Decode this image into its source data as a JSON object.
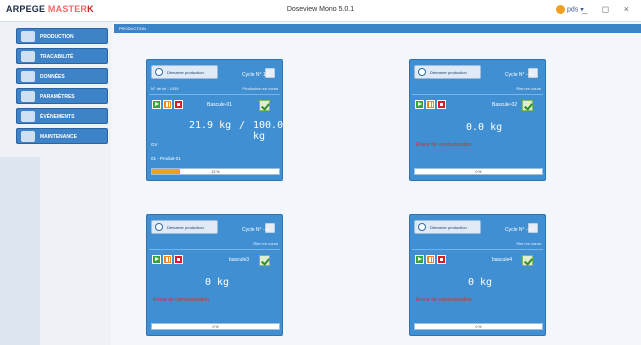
{
  "app": {
    "brand_parts": [
      "ARPEGE ",
      "MASTER",
      "K"
    ],
    "window_title": "Doseview Mono 5.0.1",
    "user": "pds",
    "window_buttons": "_ ◻ ×"
  },
  "sidebar": {
    "items": [
      {
        "label": "PRODUCTION",
        "icon": "production-icon"
      },
      {
        "label": "TRACABILITÉ",
        "icon": "traceability-icon"
      },
      {
        "label": "DONNÉES",
        "icon": "data-icon"
      },
      {
        "label": "PARAMÈTRES",
        "icon": "settings-icon"
      },
      {
        "label": "ÉVÉNEMENTS",
        "icon": "events-icon"
      },
      {
        "label": "MAINTENANCE",
        "icon": "maintenance-icon"
      }
    ]
  },
  "breadcrumb": "PRODUCTION",
  "cards": [
    {
      "start_label": "Démarrer production",
      "cycle_label": "Cycle N°",
      "cycle_value": "1/1",
      "batch_label": "N° de lot : 1039",
      "status": "Production en cours",
      "scale_name": "Bascule-01",
      "weight_current": "21.9 kg",
      "weight_sep": "/",
      "weight_target": "100.0 kg",
      "gv": "GV",
      "product": "01 - Produit-01",
      "progress_pct": 22,
      "progress_text": "22 %",
      "error": ""
    },
    {
      "start_label": "Démarrer production",
      "cycle_label": "Cycle N°",
      "cycle_value": "--/--",
      "batch_label": "",
      "status": "Rien en cours",
      "scale_name": "Bascule-02",
      "weight_current": "0.0 kg",
      "weight_sep": "",
      "weight_target": "",
      "gv": "",
      "product": "",
      "progress_pct": 0,
      "progress_text": "0 %",
      "error": "Erreur de communication"
    },
    {
      "start_label": "Démarrer production",
      "cycle_label": "Cycle N°",
      "cycle_value": "--/--",
      "batch_label": "",
      "status": "Rien en cours",
      "scale_name": "bascule3",
      "weight_current": "0 kg",
      "weight_sep": "",
      "weight_target": "",
      "gv": "",
      "product": "",
      "progress_pct": 0,
      "progress_text": "0 %",
      "error": "Erreur de communication"
    },
    {
      "start_label": "Démarrer production",
      "cycle_label": "Cycle N°",
      "cycle_value": "--/--",
      "batch_label": "",
      "status": "Rien en cours",
      "scale_name": "bascule4",
      "weight_current": "0 kg",
      "weight_sep": "",
      "weight_target": "",
      "gv": "",
      "product": "",
      "progress_pct": 0,
      "progress_text": "0 %",
      "error": "Erreur de communication"
    }
  ]
}
